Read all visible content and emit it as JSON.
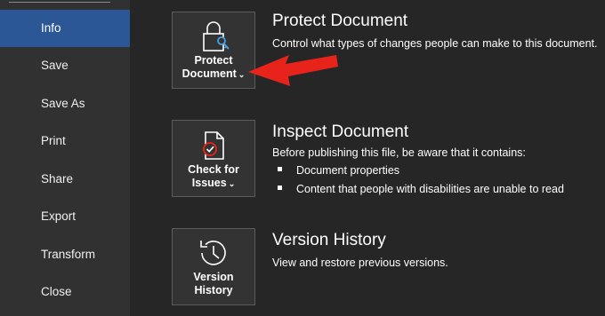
{
  "sidebar": {
    "items": [
      {
        "label": "Info",
        "active": true
      },
      {
        "label": "Save",
        "active": false
      },
      {
        "label": "Save As",
        "active": false
      },
      {
        "label": "Print",
        "active": false
      },
      {
        "label": "Share",
        "active": false
      },
      {
        "label": "Export",
        "active": false
      },
      {
        "label": "Transform",
        "active": false
      },
      {
        "label": "Close",
        "active": false
      }
    ]
  },
  "sections": [
    {
      "tile_line1": "Protect",
      "tile_line2": "Document",
      "tile_icon": "lock-icon",
      "title": "Protect Document",
      "description": "Control what types of changes people can make to this document."
    },
    {
      "tile_line1": "Check for",
      "tile_line2": "Issues",
      "tile_icon": "document-check-icon",
      "title": "Inspect Document",
      "description": "Before publishing this file, be aware that it contains:",
      "bullets": [
        "Document properties",
        "Content that people with disabilities are unable to read"
      ]
    },
    {
      "tile_line1": "Version",
      "tile_line2": "History",
      "tile_icon": "history-icon",
      "title": "Version History",
      "description": "View and restore previous versions."
    }
  ],
  "colors": {
    "background": "#262626",
    "sidebar": "#313131",
    "active": "#2b5797",
    "arrow": "#e8231c"
  }
}
